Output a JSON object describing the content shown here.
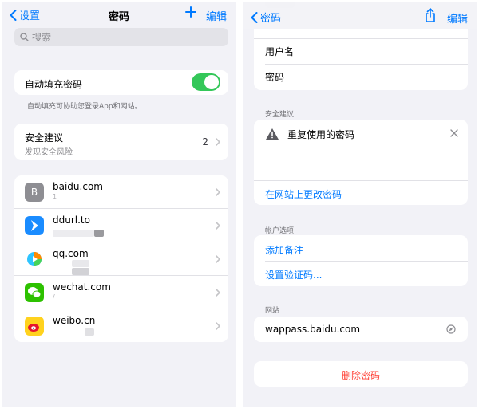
{
  "left": {
    "nav": {
      "back_label": "设置",
      "title": "密码",
      "edit_label": "编辑"
    },
    "search": {
      "placeholder": "搜索"
    },
    "autofill": {
      "label": "自动填充密码",
      "enabled": true,
      "note": "自动填充可协助您登录App和网站。"
    },
    "security": {
      "title": "安全建议",
      "subtitle": "发现安全风险",
      "count": "2"
    },
    "sites": [
      {
        "name": "baidu.com",
        "user": "1",
        "icon": "letter-b-icon",
        "letter": "B"
      },
      {
        "name": "ddurl.to",
        "user": "",
        "icon": "ddurl-app-icon"
      },
      {
        "name": "qq.com",
        "user": "",
        "icon": "qq-video-icon"
      },
      {
        "name": "wechat.com",
        "user": "/",
        "icon": "wechat-icon"
      },
      {
        "name": "weibo.cn",
        "user": "",
        "icon": "weibo-icon"
      }
    ]
  },
  "right": {
    "nav": {
      "back_label": "密码",
      "edit_label": "编辑"
    },
    "credentials": {
      "username_label": "用户名",
      "password_label": "密码"
    },
    "security_section": {
      "header": "安全建议",
      "warning": "重复使用的密码",
      "change_link": "在网站上更改密码"
    },
    "account_section": {
      "header": "帐户选项",
      "add_note": "添加备注",
      "set_code": "设置验证码..."
    },
    "website_section": {
      "header": "网站",
      "url": "wappass.baidu.com"
    },
    "delete_label": "删除密码"
  },
  "colors": {
    "accent": "#007aff",
    "toggle_on": "#34c759",
    "danger": "#ff3b30",
    "background": "#f2f2f7"
  }
}
